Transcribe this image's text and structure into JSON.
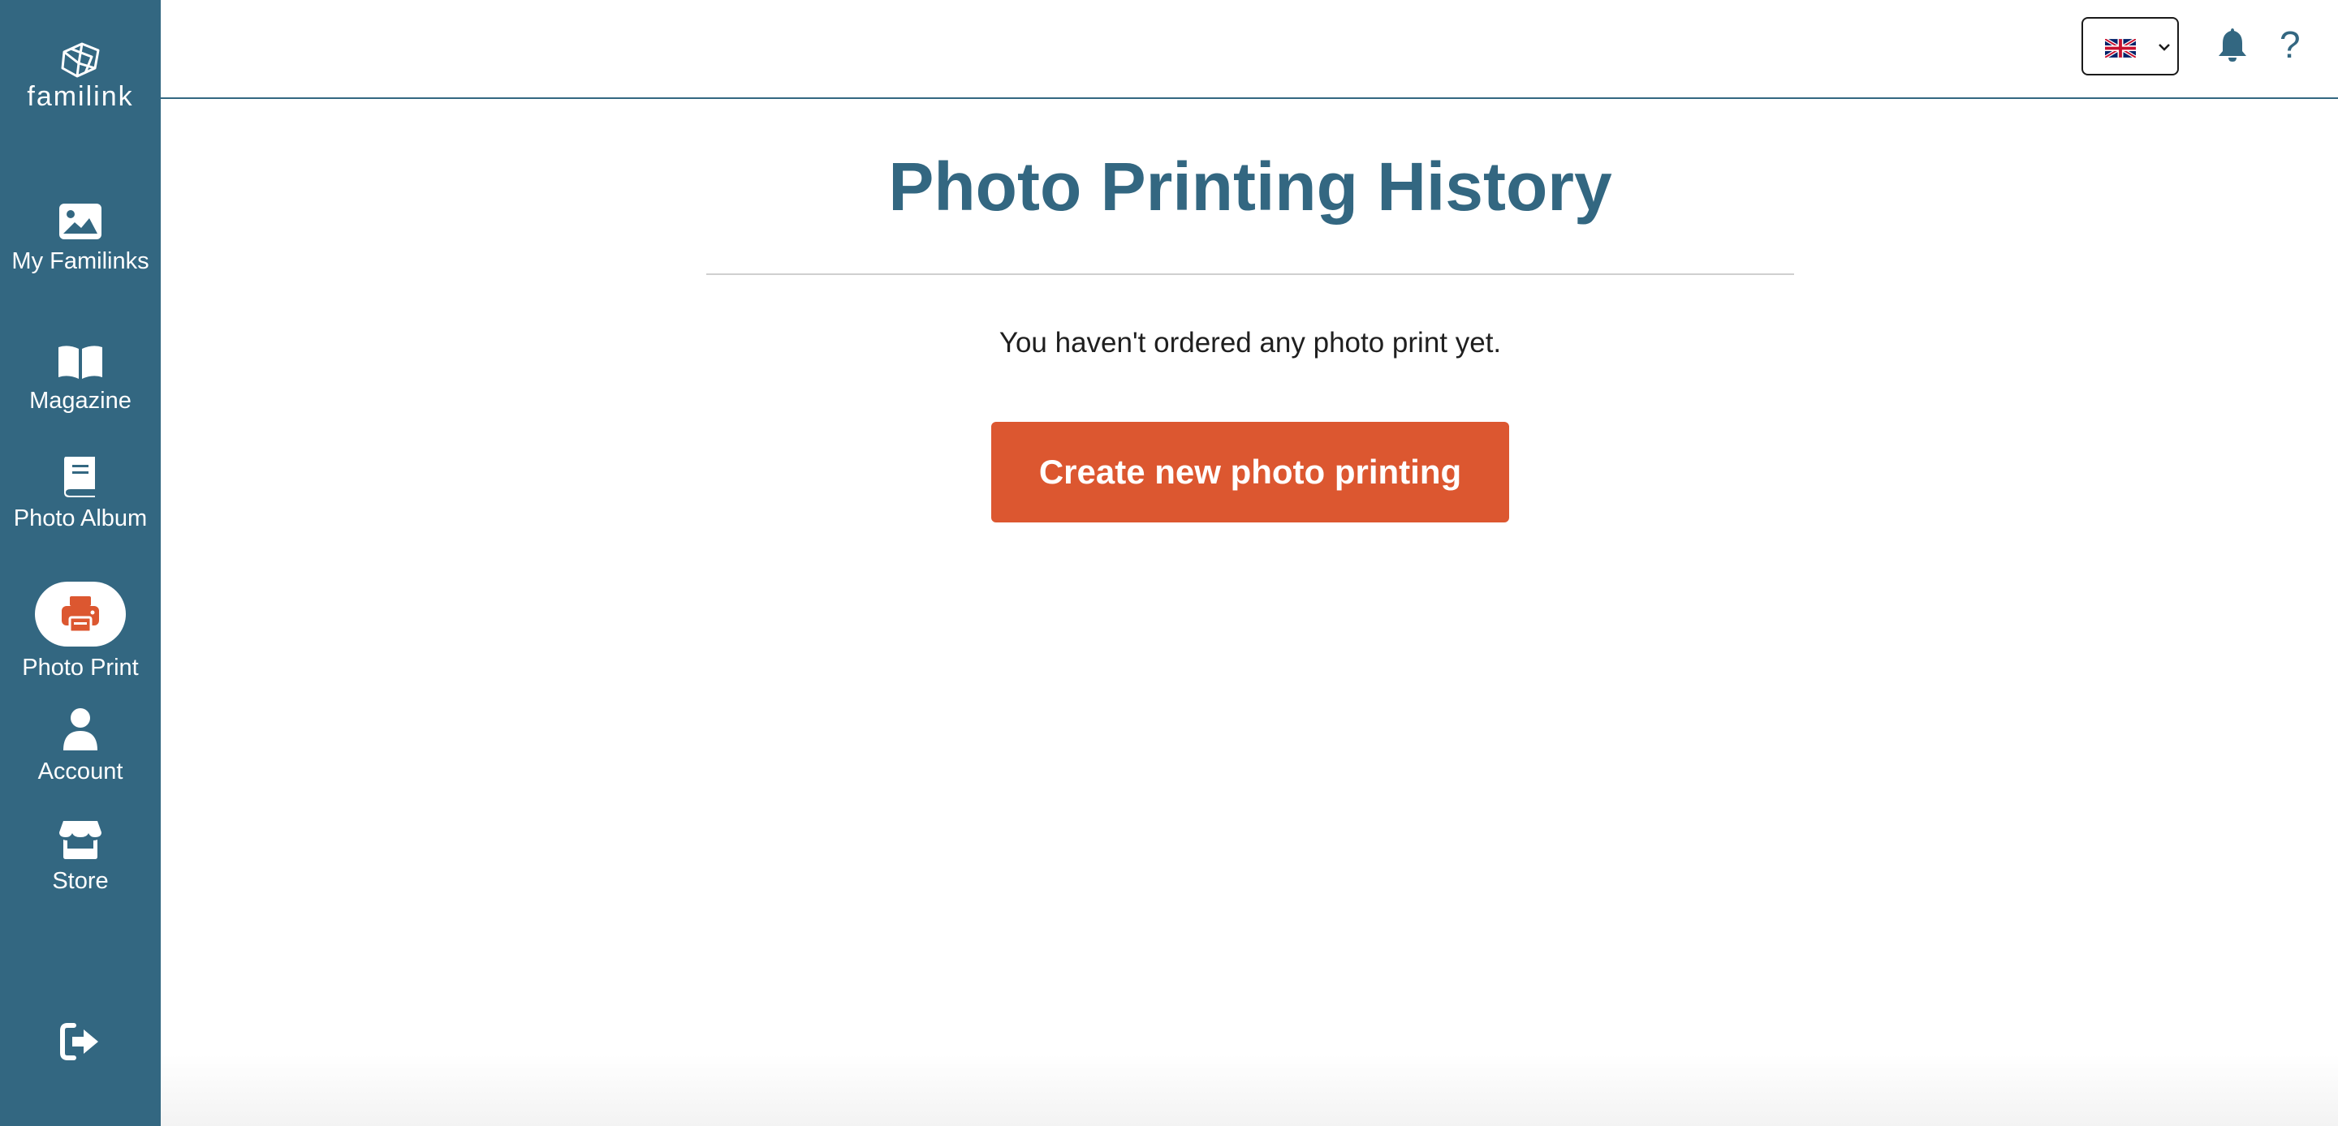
{
  "app": {
    "logo_text": "familink"
  },
  "sidebar": {
    "items": [
      {
        "label": "My Familinks",
        "icon": "image-icon"
      },
      {
        "label": "Magazine",
        "icon": "book-open-icon"
      },
      {
        "label": "Photo Album",
        "icon": "album-icon"
      },
      {
        "label": "Photo Print",
        "icon": "printer-icon",
        "active": true
      },
      {
        "label": "Account",
        "icon": "user-icon"
      },
      {
        "label": "Store",
        "icon": "store-icon"
      }
    ],
    "logout_icon": "logout-icon"
  },
  "header": {
    "language_flag": "uk-flag",
    "notification_icon": "bell-icon",
    "help_label": "?"
  },
  "main": {
    "title": "Photo Printing History",
    "empty_message": "You haven't ordered any photo print yet.",
    "create_button_label": "Create new photo printing"
  },
  "colors": {
    "sidebar": "#336781",
    "primary_text": "#336781",
    "accent": "#dc5730"
  }
}
